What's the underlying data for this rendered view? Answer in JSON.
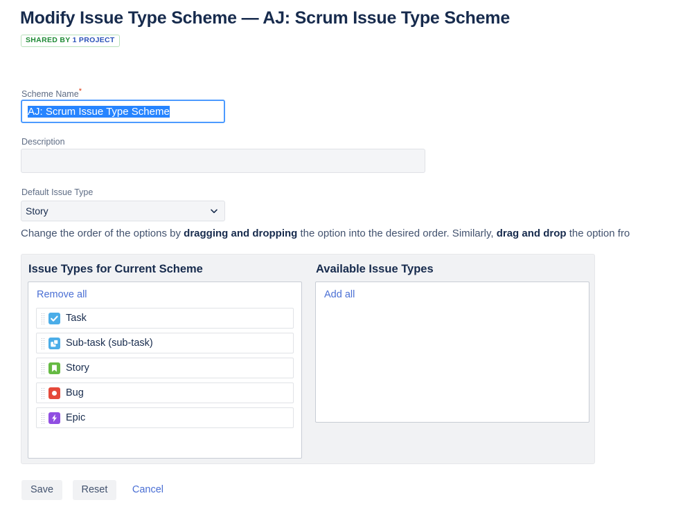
{
  "header": {
    "title": "Modify Issue Type Scheme — AJ: Scrum Issue Type Scheme",
    "badge": {
      "shared_text": "SHARED BY",
      "project_text": "1 PROJECT",
      "shared_color": "#1e8a35",
      "project_color": "#2a51b8",
      "border_color": "#b7e0b9"
    }
  },
  "form": {
    "scheme_name": {
      "label": "Scheme Name",
      "required_marker": "*",
      "value": "AJ: Scrum Issue Type Scheme",
      "placeholder": ""
    },
    "description": {
      "label": "Description",
      "value": "",
      "placeholder": ""
    },
    "default_issue_type": {
      "label": "Default Issue Type",
      "selected": "Story",
      "options": [
        "Story"
      ],
      "chevron_icon": "chevron-down-icon"
    }
  },
  "instructions": {
    "part1": "Change the order of the options by ",
    "bold1": "dragging and dropping",
    "part2": " the option into the desired order. Similarly, ",
    "bold2": "drag and drop",
    "part3": " the option fro"
  },
  "current_scheme": {
    "heading": "Issue Types for Current Scheme",
    "bulk_link": "Remove all",
    "items": [
      {
        "label": "Task",
        "icon": "task-icon",
        "icon_color": "#4bade8",
        "grip": "drag-handle-icon"
      },
      {
        "label": "Sub-task (sub-task)",
        "icon": "subtask-icon",
        "icon_color": "#4bade8",
        "grip": "drag-handle-icon"
      },
      {
        "label": "Story",
        "icon": "story-icon",
        "icon_color": "#65ba43",
        "grip": "drag-handle-icon"
      },
      {
        "label": "Bug",
        "icon": "bug-icon",
        "icon_color": "#e5493a",
        "grip": "drag-handle-icon"
      },
      {
        "label": "Epic",
        "icon": "epic-icon",
        "icon_color": "#904ee2",
        "grip": "drag-handle-icon"
      }
    ]
  },
  "available_types": {
    "heading": "Available Issue Types",
    "bulk_link": "Add all",
    "items": []
  },
  "footer": {
    "save_label": "Save",
    "reset_label": "Reset",
    "cancel_label": "Cancel"
  },
  "colors": {
    "link": "#4a6fd4",
    "text": "#172b4d",
    "muted": "#5e6c84",
    "panel_bg": "#f1f2f4",
    "focus_border": "#4c9aff",
    "selection_bg": "#2684ff"
  }
}
